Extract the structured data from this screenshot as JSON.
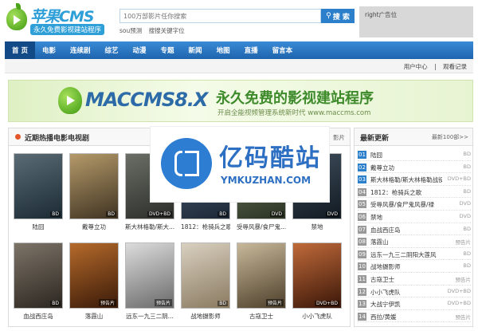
{
  "header": {
    "logo_name": "苹果CMS",
    "logo_slogan": "永久免费影视建站程序",
    "search_placeholder": "100万部影片任你搜索",
    "search_button": "搜 索",
    "hot_label": "sou预测",
    "hot_keyword": "搜搜关键字位",
    "ad_right": "right广告位"
  },
  "nav": {
    "items": [
      "首 页",
      "电影",
      "连续剧",
      "综艺",
      "动漫",
      "专题",
      "新闻",
      "地图",
      "直播",
      "留言本"
    ],
    "active_index": 0,
    "user_center": "用户中心",
    "history": "观看记录"
  },
  "banner": {
    "name": "MACCMS8.X",
    "slogan": "永久免费的影视建站程序",
    "sub": "开启全能视频管理系统新时代 www.maccms.com"
  },
  "hot_section": {
    "title": "近期热播电影电视剧",
    "more": "影片",
    "movies": [
      {
        "title": "陆囧",
        "tag": "BD",
        "colors": [
          "#5a6b76",
          "#1b2a33"
        ]
      },
      {
        "title": "戴尊立功",
        "tag": "BD",
        "colors": [
          "#b59a6a",
          "#3f3322"
        ]
      },
      {
        "title": "斯大林格勒/斯大...",
        "tag": "DVD+BD",
        "colors": [
          "#6b6e66",
          "#2b2d29"
        ]
      },
      {
        "title": "1812：枪骑兵之歌",
        "tag": "BD",
        "colors": [
          "#4a5f78",
          "#1c2735"
        ]
      },
      {
        "title": "受辱风暴/食尸鬼...",
        "tag": "DVD",
        "colors": [
          "#6e7b5f",
          "#2a3222"
        ]
      },
      {
        "title": "禁地",
        "tag": "DVD",
        "colors": [
          "#3e4d5c",
          "#121a22"
        ]
      },
      {
        "title": "血战西庄岛",
        "tag": "BD",
        "colors": [
          "#7d7468",
          "#2b2620"
        ]
      },
      {
        "title": "落霞山",
        "tag": "预告片",
        "colors": [
          "#b56a2b",
          "#3a1a08"
        ]
      },
      {
        "title": "远东一九三二阴...",
        "tag": "预告片",
        "colors": [
          "#dcdcdc",
          "#6a6a6a"
        ]
      },
      {
        "title": "战地摄影师",
        "tag": "BD",
        "colors": [
          "#d9d0c0",
          "#8a7a60"
        ]
      },
      {
        "title": "古寇卫士",
        "tag": "预告片",
        "colors": [
          "#c8b89a",
          "#4d3f2a"
        ]
      },
      {
        "title": "小小飞虎队",
        "tag": "DVD+BD",
        "colors": [
          "#c06a3a",
          "#3a1608"
        ]
      }
    ]
  },
  "latest": {
    "title": "最新更新",
    "more": "最新100部>>",
    "items": [
      {
        "num": "01",
        "name": "陆囧",
        "status": "BD"
      },
      {
        "num": "02",
        "name": "戴尊立功",
        "status": "BD"
      },
      {
        "num": "03",
        "name": "斯大林格勒/斯大林格勒战役",
        "status": "DVD+BD"
      },
      {
        "num": "04",
        "name": "1812：枪骑兵之歌",
        "status": "BD"
      },
      {
        "num": "05",
        "name": "受辱风暴/食尸鬼风暴/禄",
        "status": "DVD"
      },
      {
        "num": "06",
        "name": "禁地",
        "status": "DVD"
      },
      {
        "num": "07",
        "name": "血战西庄岛",
        "status": "BD"
      },
      {
        "num": "08",
        "name": "落霞山",
        "status": "预告片"
      },
      {
        "num": "09",
        "name": "远东一九三二阴阳大莲风",
        "status": "BD"
      },
      {
        "num": "10",
        "name": "战地摄影师",
        "status": "BD"
      },
      {
        "num": "11",
        "name": "古寇卫士",
        "status": "预告片"
      },
      {
        "num": "12",
        "name": "小小飞虎队",
        "status": "DVD+BD"
      },
      {
        "num": "13",
        "name": "大战宁伊凯",
        "status": "DVD+BD"
      },
      {
        "num": "14",
        "name": "西拉/黄媛",
        "status": "预告片"
      }
    ]
  },
  "watermark": {
    "cn": "亿码酷站",
    "en": "YMKUZHAN.COM"
  }
}
